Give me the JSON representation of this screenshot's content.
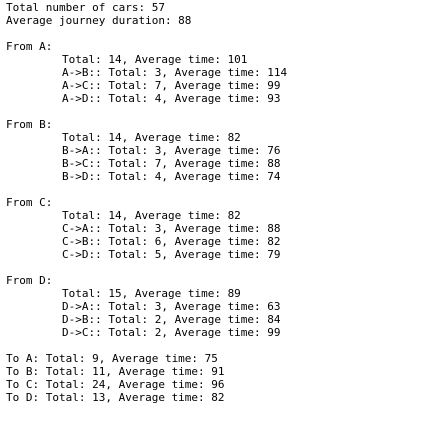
{
  "summary": {
    "total_cars": "Total number of cars: 57",
    "avg_duration": "Average journey duration: 88"
  },
  "from": [
    {
      "header": "From A:",
      "total": "Total: 14, Average time: 101",
      "routes": [
        "A->B:: Total: 3, Average time: 114",
        "A->C:: Total: 7, Average time: 99",
        "A->D:: Total: 4, Average time: 93"
      ]
    },
    {
      "header": "From B:",
      "total": "Total: 14, Average time: 82",
      "routes": [
        "B->A:: Total: 3, Average time: 76",
        "B->C:: Total: 7, Average time: 88",
        "B->D:: Total: 4, Average time: 74"
      ]
    },
    {
      "header": "From C:",
      "total": "Total: 14, Average time: 82",
      "routes": [
        "C->A:: Total: 3, Average time: 88",
        "C->B:: Total: 6, Average time: 82",
        "C->D:: Total: 5, Average time: 79"
      ]
    },
    {
      "header": "From D:",
      "total": "Total: 15, Average time: 89",
      "routes": [
        "D->A:: Total: 3, Average time: 63",
        "D->B:: Total: 2, Average time: 84",
        "D->C:: Total: 2, Average time: 99"
      ]
    }
  ],
  "to": [
    "To A: Total: 9, Average time: 75",
    "To B: Total: 11, Average time: 91",
    "To C: Total: 24, Average time: 96",
    "To D: Total: 13, Average time: 82"
  ]
}
